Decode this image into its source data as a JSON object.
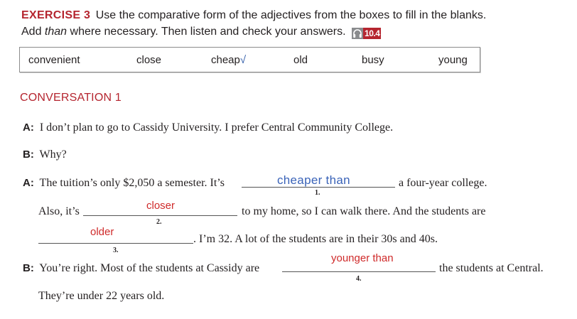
{
  "exercise": {
    "label": "EXERCISE 3",
    "instruction_line1": "Use the comparative form of the adjectives from the boxes to fill in the blanks.",
    "instruction_line2_pre": "Add ",
    "instruction_line2_em": "than",
    "instruction_line2_post": " where necessary. Then listen and check your answers.",
    "audio_track": "10.4",
    "audio_icon": "headphones-icon",
    "accent_color": "#b5252f"
  },
  "word_box": {
    "words": [
      "convenient",
      "close",
      "cheap",
      "old",
      "busy",
      "young"
    ],
    "checkmark": "√"
  },
  "conversation": {
    "title": "CONVERSATION 1",
    "lines": [
      {
        "speaker": "A:",
        "text": "I don’t plan to go to Cassidy University. I prefer Central Community College."
      },
      {
        "speaker": "B:",
        "text": "Why?"
      },
      {
        "speaker": "A:",
        "text_before": "The tuition’s only $2,050 a semester. It’s",
        "text_after": "a four-year college."
      },
      {
        "text_before": "Also, it’s",
        "text_after": "to my home, so I can walk there. And the students are"
      },
      {
        "text_after": ". I’m 32. A lot of the students are in their 30s and 40s."
      },
      {
        "speaker": "B:",
        "text_before": "You’re right. Most of the students at Cassidy are",
        "text_after": "the students at Central."
      },
      {
        "text": "They’re under 22 years old."
      }
    ],
    "blanks": [
      {
        "number": "1.",
        "answer": "cheaper than",
        "answer_color": "#3a63b8"
      },
      {
        "number": "2.",
        "answer": "closer",
        "answer_color": "#cf2a2a"
      },
      {
        "number": "3.",
        "answer": "older",
        "answer_color": "#cf2a2a"
      },
      {
        "number": "4.",
        "answer": "younger than",
        "answer_color": "#cf2a2a"
      }
    ]
  }
}
